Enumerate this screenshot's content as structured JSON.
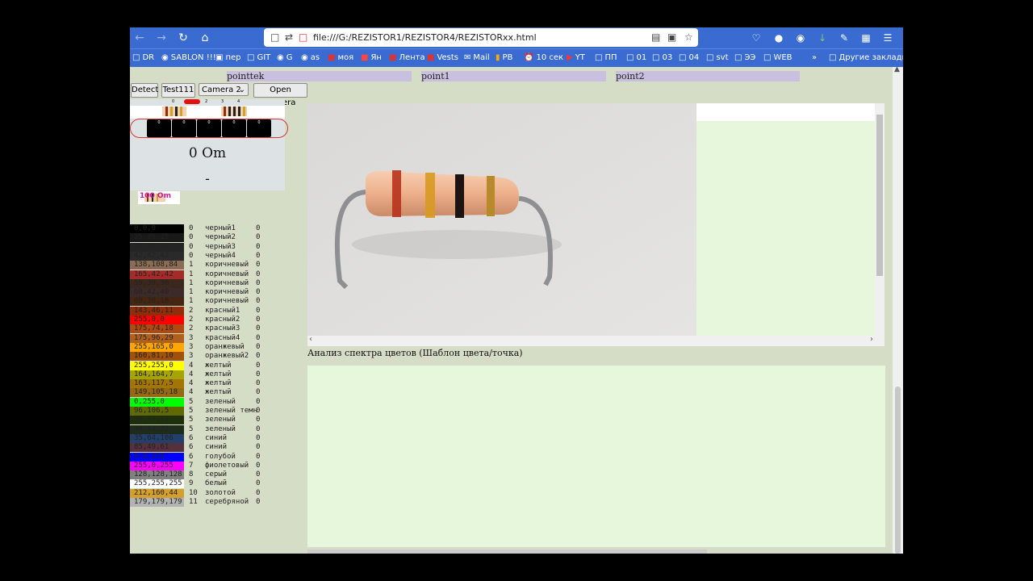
{
  "browser": {
    "url": "file:///G:/REZISTOR1/REZISTOR4/REZISTORxx.html",
    "bookmarks": [
      "DR",
      "SABLON !!!",
      "пер",
      "GIT",
      "G",
      "as",
      "моя",
      "Ян",
      "Лента",
      "Vests",
      "Mail",
      "PB",
      "10 сек",
      "YT",
      "ПП",
      "01",
      "03",
      "04",
      "svt",
      "ЭЭ",
      "WEB"
    ],
    "other_bookmarks": "Другие закладки"
  },
  "tabs": {
    "t1": "pointtek",
    "t2": "point1",
    "t3": "point2"
  },
  "toolbar": {
    "detect": "Detect",
    "test": "Test111",
    "camera_select": "Camera 2",
    "open_camera": "Open camera"
  },
  "mini": {
    "numbers": [
      "0",
      "1",
      "2",
      "3",
      "4"
    ]
  },
  "display": {
    "codes": [
      "0",
      "0",
      "0",
      "0",
      "0"
    ],
    "resistance": "0 Om",
    "sub": "-",
    "tiny": "100 Om"
  },
  "analysis_label": "Анализ спектра цветов (Шаблон цвета/точка)",
  "colors": [
    {
      "rgb": "0,0,0",
      "hex": "#000000",
      "digit": "0",
      "name": "черный1",
      "count": "0"
    },
    {
      "rgb": "25,25,25",
      "hex": "#191919",
      "digit": "0",
      "name": "черный2",
      "count": "0"
    },
    {
      "rgb": "36,36,36",
      "hex": "#242424",
      "digit": "0",
      "name": "черный3",
      "count": "0"
    },
    {
      "rgb": "42,42,42",
      "hex": "#2a2a2a",
      "digit": "0",
      "name": "черный4",
      "count": "0"
    },
    {
      "rgb": "138,108,84",
      "hex": "#8a6c54",
      "digit": "1",
      "name": "коричневый",
      "count": "0"
    },
    {
      "rgb": "165,42,42",
      "hex": "#a52a2a",
      "digit": "1",
      "name": "коричневый",
      "count": "0"
    },
    {
      "rgb": "59,39,30",
      "hex": "#3b271e",
      "digit": "1",
      "name": "коричневый",
      "count": "0"
    },
    {
      "rgb": "60,42,40",
      "hex": "#3c2a28",
      "digit": "1",
      "name": "коричневый",
      "count": "0"
    },
    {
      "rgb": "69,38,18",
      "hex": "#452612",
      "digit": "1",
      "name": "коричневый",
      "count": "0"
    },
    {
      "rgb": "143,46,11",
      "hex": "#8f2e0b",
      "digit": "2",
      "name": "красный1",
      "count": "0"
    },
    {
      "rgb": "255,0,0",
      "hex": "#ff0000",
      "digit": "2",
      "name": "красный2",
      "count": "0"
    },
    {
      "rgb": "175,74,18",
      "hex": "#af4a12",
      "digit": "2",
      "name": "красный3",
      "count": "0"
    },
    {
      "rgb": "175,96,29",
      "hex": "#af601d",
      "digit": "3",
      "name": "красный4",
      "count": "0"
    },
    {
      "rgb": "255,165,0",
      "hex": "#ffa500",
      "digit": "3",
      "name": "оранжевый",
      "count": "0"
    },
    {
      "rgb": "160,81,10",
      "hex": "#a0510a",
      "digit": "3",
      "name": "оранжевый2",
      "count": "0"
    },
    {
      "rgb": "255,255,0",
      "hex": "#ffff00",
      "digit": "4",
      "name": "желтый",
      "count": "0"
    },
    {
      "rgb": "164,164,7",
      "hex": "#a4a407",
      "digit": "4",
      "name": "желтый",
      "count": "0"
    },
    {
      "rgb": "163,117,5",
      "hex": "#a37505",
      "digit": "4",
      "name": "желтый",
      "count": "0"
    },
    {
      "rgb": "149,105,18",
      "hex": "#956912",
      "digit": "4",
      "name": "желтый",
      "count": "0"
    },
    {
      "rgb": "0,255,0",
      "hex": "#00ff00",
      "digit": "5",
      "name": "зеленый",
      "count": "0"
    },
    {
      "rgb": "96,106,5",
      "hex": "#606a05",
      "digit": "5",
      "name": "зеленый темн",
      "count": "0"
    },
    {
      "rgb": "30,47,11",
      "hex": "#1e2f0b",
      "digit": "5",
      "name": "зеленый",
      "count": "0"
    },
    {
      "rgb": "30,44,27",
      "hex": "#1e2c1b",
      "digit": "5",
      "name": "зеленый",
      "count": "0"
    },
    {
      "rgb": "35,64,106",
      "hex": "#23406a",
      "digit": "6",
      "name": "синий",
      "count": "0"
    },
    {
      "rgb": "85,49,61",
      "hex": "#55313d",
      "digit": "6",
      "name": "синий",
      "count": "0"
    },
    {
      "rgb": "0,0,255",
      "hex": "#0000ff",
      "digit": "6",
      "name": "голубой",
      "count": "0"
    },
    {
      "rgb": "255,0,255",
      "hex": "#ff00ff",
      "digit": "7",
      "name": "фиолетовый",
      "count": "0"
    },
    {
      "rgb": "128,128,128",
      "hex": "#808080",
      "digit": "8",
      "name": "серый",
      "count": "0"
    },
    {
      "rgb": "255,255,255",
      "hex": "#ffffff",
      "digit": "9",
      "name": "белый",
      "count": "0"
    },
    {
      "rgb": "212,160,44",
      "hex": "#d4a02c",
      "digit": "10",
      "name": "золотой",
      "count": "0"
    },
    {
      "rgb": "179,179,179",
      "hex": "#b3b3b3",
      "digit": "11",
      "name": "серебряной",
      "count": "0"
    }
  ]
}
